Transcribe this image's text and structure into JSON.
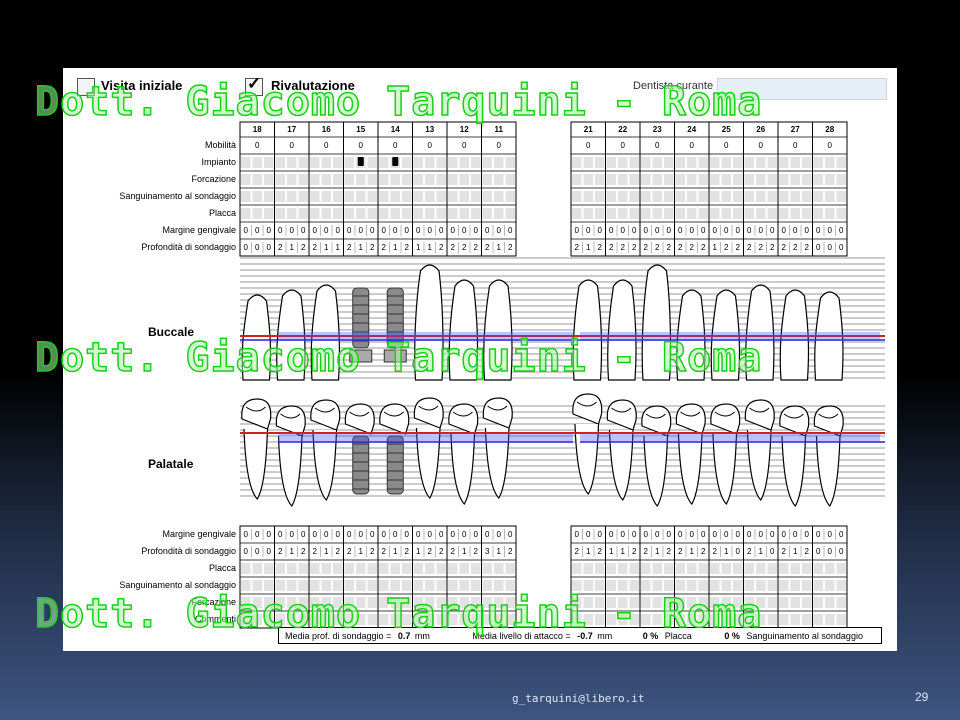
{
  "header": {
    "visita_label": "Visita iniziale",
    "visita_checked": false,
    "rivalutazione_label": "Rivalutazione",
    "rivalutazione_checked": true,
    "dentista_label": "Dentista curante",
    "dentista_value": ""
  },
  "upper": {
    "teeth": [
      "18",
      "17",
      "16",
      "15",
      "14",
      "13",
      "12",
      "11",
      "21",
      "22",
      "23",
      "24",
      "25",
      "26",
      "27",
      "28"
    ],
    "rows": [
      "Mobilità",
      "Impianto",
      "Forcazione",
      "Sanguinamento al sondaggio",
      "Placca",
      "Margine gengivale",
      "Profondità di sondaggio"
    ],
    "mobilita": [
      "0",
      "0",
      "0",
      "0",
      "0",
      "0",
      "0",
      "0",
      "0",
      "0",
      "0",
      "0",
      "0",
      "0",
      "0",
      "0"
    ],
    "impianti": [
      "15",
      "14"
    ],
    "margine": [
      "0",
      "0",
      "0",
      "0",
      "0",
      "0",
      "0",
      "0",
      "0",
      "0",
      "0",
      "0",
      "0",
      "0",
      "0",
      "0",
      "0",
      "0",
      "0",
      "0",
      "0",
      "0",
      "0",
      "0",
      "0",
      "0",
      "0",
      "0",
      "0",
      "0",
      "0",
      "0",
      "0",
      "0",
      "0",
      "0",
      "0",
      "0",
      "0",
      "0",
      "0",
      "0",
      "0",
      "0",
      "0",
      "0",
      "0",
      "0"
    ],
    "profondita": [
      "0",
      "0",
      "0",
      "2",
      "1",
      "2",
      "2",
      "1",
      "1",
      "2",
      "1",
      "2",
      "2",
      "1",
      "2",
      "1",
      "1",
      "2",
      "2",
      "2",
      "2",
      "2",
      "1",
      "2",
      "2",
      "1",
      "2",
      "2",
      "2",
      "2",
      "2",
      "2",
      "2",
      "2",
      "2",
      "2",
      "1",
      "2",
      "2",
      "2",
      "2",
      "2",
      "2",
      "2",
      "2",
      "0",
      "0",
      "0"
    ]
  },
  "sections": {
    "buccale": "Buccale",
    "palatale": "Palatale"
  },
  "lower": {
    "rows": [
      "Margine gengivale",
      "Profondità di sondaggio",
      "Placca",
      "Sanguinamento al sondaggio",
      "Forcazione",
      "Commenti"
    ],
    "margine": [
      "0",
      "0",
      "0",
      "0",
      "0",
      "0",
      "0",
      "0",
      "0",
      "0",
      "0",
      "0",
      "0",
      "0",
      "0",
      "0",
      "0",
      "0",
      "0",
      "0",
      "0",
      "0",
      "0",
      "0",
      "0",
      "0",
      "0",
      "0",
      "0",
      "0",
      "0",
      "0",
      "0",
      "0",
      "0",
      "0",
      "0",
      "0",
      "0",
      "0",
      "0",
      "0",
      "0",
      "0",
      "0",
      "0",
      "0",
      "0"
    ],
    "profondita": [
      "0",
      "0",
      "0",
      "2",
      "1",
      "2",
      "2",
      "1",
      "2",
      "2",
      "1",
      "2",
      "2",
      "1",
      "2",
      "1",
      "2",
      "2",
      "2",
      "1",
      "2",
      "3",
      "1",
      "2",
      "2",
      "1",
      "2",
      "1",
      "1",
      "2",
      "2",
      "1",
      "2",
      "2",
      "1",
      "2",
      "2",
      "1",
      "0",
      "2",
      "1",
      "0",
      "2",
      "1",
      "2",
      "0",
      "0",
      "0"
    ]
  },
  "summary": {
    "media_prof_label": "Media prof. di sondaggio =",
    "media_prof_value": "0.7",
    "unit": "mm",
    "media_livello_label": "Media livello di attacco =",
    "media_livello_value": "-0.7",
    "placca_pct": "0 %",
    "placca_label": "Placca",
    "sanguinamento_pct": "0 %",
    "sanguinamento_label": "Sanguinamento al sondaggio"
  },
  "watermark": "Dott. Giacomo Tarquini - Roma",
  "footer": {
    "email": "g_tarquini@libero.it",
    "page": "29"
  },
  "colors": {
    "gum_line": "#d02020",
    "probe_line": "#2020d0",
    "probe_fill": "#4a4aff",
    "watermark_stroke": "#18d018"
  }
}
